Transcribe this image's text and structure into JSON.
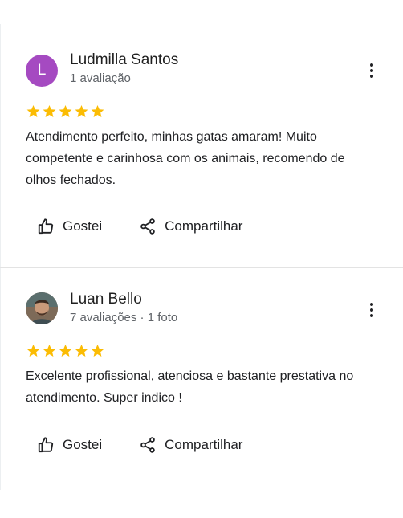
{
  "reviews": [
    {
      "avatar_letter": "L",
      "avatar_color": "#a54ac1",
      "name": "Ludmilla Santos",
      "meta": "1 avaliação",
      "rating": 5,
      "text": "Atendimento perfeito, minhas gatas amaram! Muito competente e carinhosa com os animais, recomendo de olhos fechados.",
      "like_label": "Gostei",
      "share_label": "Compartilhar"
    },
    {
      "avatar_letter": "",
      "name": "Luan Bello",
      "meta": "7 avaliações · 1 foto",
      "rating": 5,
      "text": "Excelente profissional, atenciosa e bastante prestativa no atendimento. Super indico !",
      "like_label": "Gostei",
      "share_label": "Compartilhar"
    }
  ],
  "colors": {
    "star": "#fbbc04",
    "divider": "#e3e3e3"
  },
  "icons": {
    "like": "thumb-up-icon",
    "share": "share-icon",
    "more": "more-vert-icon",
    "star": "star-icon"
  }
}
